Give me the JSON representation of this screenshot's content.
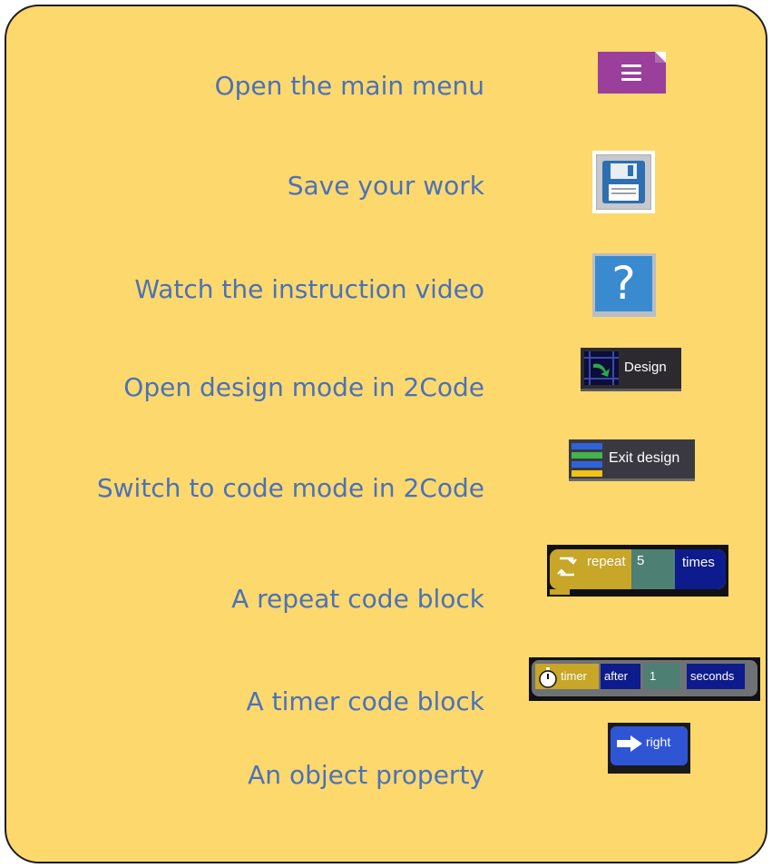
{
  "rows": [
    {
      "label": "Open the main menu"
    },
    {
      "label": "Save your work"
    },
    {
      "label": "Watch the instruction video"
    },
    {
      "label": "Open design mode in 2Code"
    },
    {
      "label": "Switch to code mode in 2Code"
    },
    {
      "label": "A repeat code block"
    },
    {
      "label": "A timer code block"
    },
    {
      "label": "An object property"
    }
  ],
  "help_button": {
    "glyph": "?"
  },
  "design_button": {
    "label": "Design"
  },
  "exit_design_button": {
    "label": "Exit design"
  },
  "repeat_block": {
    "keyword": "repeat",
    "count": "5",
    "suffix": "times"
  },
  "timer_block": {
    "keyword": "timer",
    "after": "after",
    "value": "1",
    "unit": "seconds"
  },
  "property_block": {
    "value": "right"
  },
  "colors": {
    "card_background": "#fdd86d",
    "label_text": "#4a72b8",
    "menu_button": "#9a3f9c",
    "help_button": "#3a8ad0",
    "repeat_block": "#c7a628",
    "block_navy": "#0e1b8c",
    "property_block": "#2f55d5"
  },
  "icons": [
    "hamburger-menu-icon",
    "floppy-disk-icon",
    "question-mark-icon",
    "design-grid-icon",
    "code-layers-icon",
    "loop-icon",
    "stopwatch-icon",
    "right-arrow-icon"
  ]
}
